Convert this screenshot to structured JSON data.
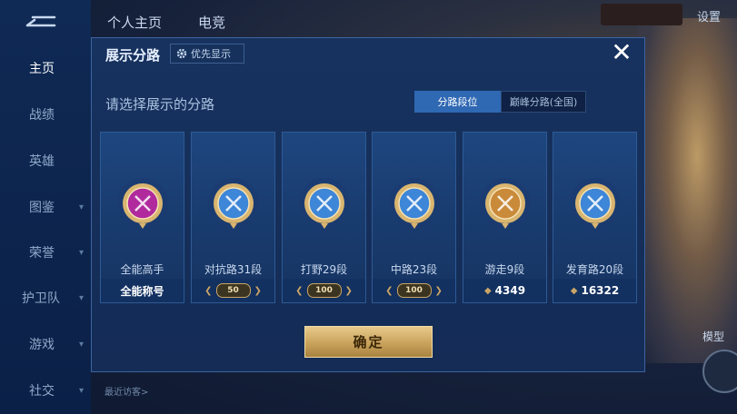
{
  "background": {
    "top_tabs": [
      "个人主页",
      "电竞"
    ],
    "settings_label": "设置",
    "sidebar_items": [
      {
        "label": "主页",
        "active": true
      },
      {
        "label": "战绩"
      },
      {
        "label": "英雄"
      },
      {
        "label": "图鉴"
      },
      {
        "label": "荣誉"
      },
      {
        "label": "护卫队"
      },
      {
        "label": "游戏"
      },
      {
        "label": "社交"
      }
    ],
    "recent_visitors": "最近访客>",
    "model_label": "模型"
  },
  "modal": {
    "title": "展示分路",
    "priority_button": "优先显示",
    "close_icon": "close-icon",
    "subtitle": "请选择展示的分路",
    "toggle": {
      "option_a": "分路段位",
      "option_b": "巅峰分路(全国)",
      "selected": "分路段位"
    },
    "confirm_label": "确定",
    "cards": [
      {
        "name": "全能高手",
        "bottom": "全能称号",
        "badge_color": "#b02a9e",
        "type": "title"
      },
      {
        "name": "对抗路31段",
        "bottom": "50",
        "badge_color": "#3d86d8",
        "type": "rank"
      },
      {
        "name": "打野29段",
        "bottom": "100",
        "badge_color": "#3d86d8",
        "type": "rank"
      },
      {
        "name": "中路23段",
        "bottom": "100",
        "badge_color": "#3d86d8",
        "type": "rank"
      },
      {
        "name": "游走9段",
        "bottom": "4349",
        "badge_color": "#c98a3a",
        "type": "score"
      },
      {
        "name": "发育路20段",
        "bottom": "16322",
        "badge_color": "#3d86d8",
        "type": "score"
      }
    ]
  }
}
